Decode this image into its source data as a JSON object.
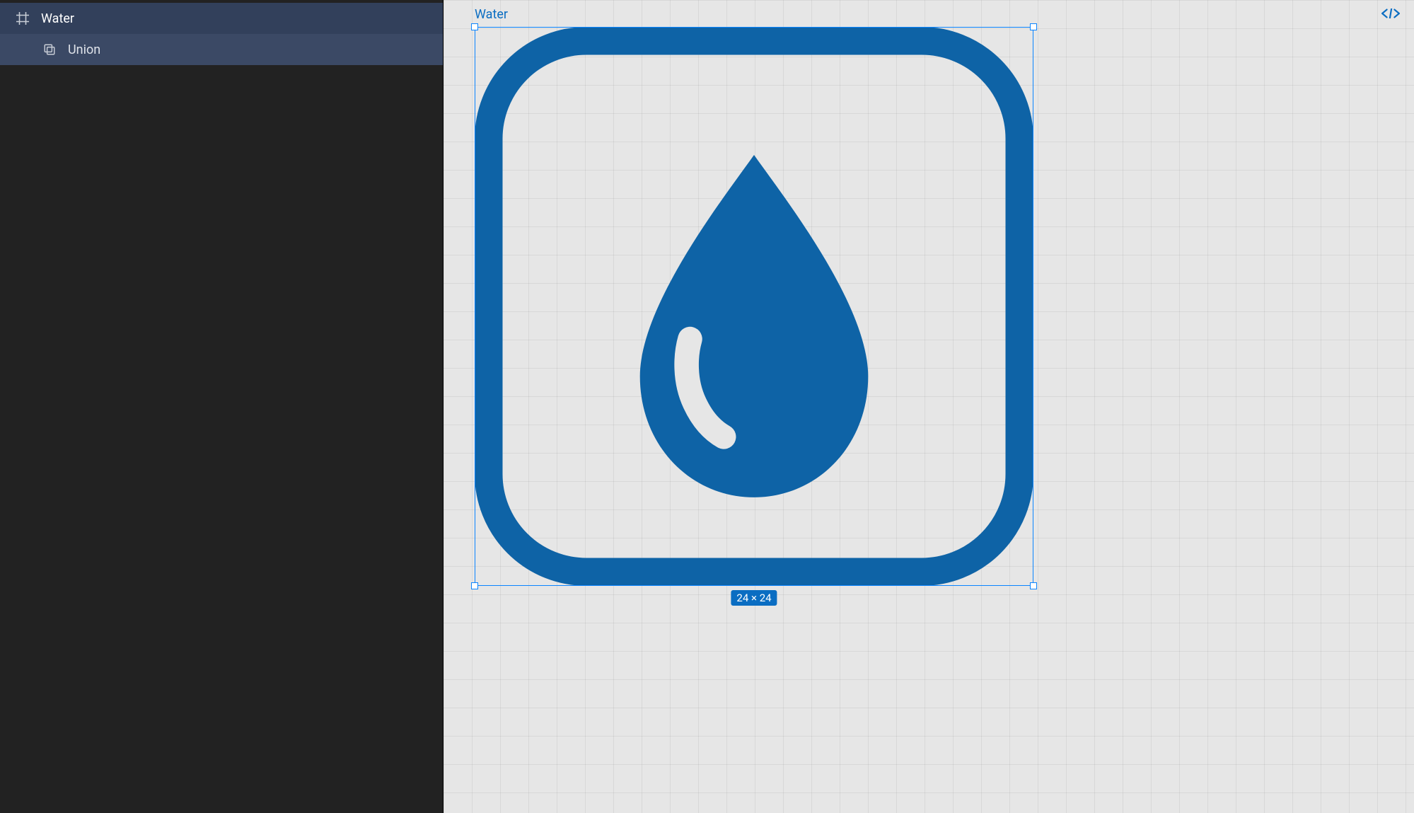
{
  "layers": {
    "frame": {
      "name": "Water"
    },
    "child": {
      "name": "Union"
    }
  },
  "canvas": {
    "frame_label": "Water",
    "dimension_badge": "24 × 24",
    "code_toggle_tooltip": "</>",
    "icon_color": "#0e63a6"
  }
}
